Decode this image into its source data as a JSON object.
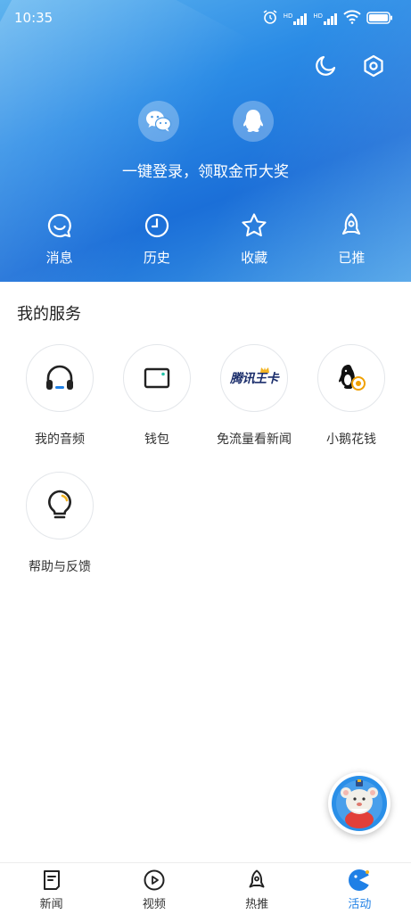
{
  "status_bar": {
    "time": "10:35",
    "net1": "HD",
    "net2": "HD"
  },
  "header": {
    "login_text": "一键登录，领取金币大奖",
    "quick_items": [
      {
        "label": "消息",
        "icon": "smile-chat-icon"
      },
      {
        "label": "历史",
        "icon": "clock-icon"
      },
      {
        "label": "收藏",
        "icon": "star-icon"
      },
      {
        "label": "已推",
        "icon": "rocket-icon"
      }
    ]
  },
  "services": {
    "title": "我的服务",
    "items": [
      {
        "label": "我的音频",
        "icon": "headphones-icon"
      },
      {
        "label": "钱包",
        "icon": "wallet-icon"
      },
      {
        "label": "免流量看新闻",
        "icon": "tencent-wangka-logo",
        "logo_text": "腾讯王卡"
      },
      {
        "label": "小鹅花钱",
        "icon": "penguin-coin-icon"
      },
      {
        "label": "帮助与反馈",
        "icon": "lightbulb-icon"
      }
    ]
  },
  "bottom_nav": [
    {
      "label": "新闻",
      "icon": "news-icon",
      "active": false
    },
    {
      "label": "视频",
      "icon": "play-icon",
      "active": false
    },
    {
      "label": "热推",
      "icon": "rocket-icon",
      "active": false
    },
    {
      "label": "活动",
      "icon": "activity-icon",
      "active": true
    }
  ],
  "colors": {
    "accent": "#1f80e6",
    "header_top": "#5fb4ef",
    "header_mid": "#1b6fd8"
  }
}
